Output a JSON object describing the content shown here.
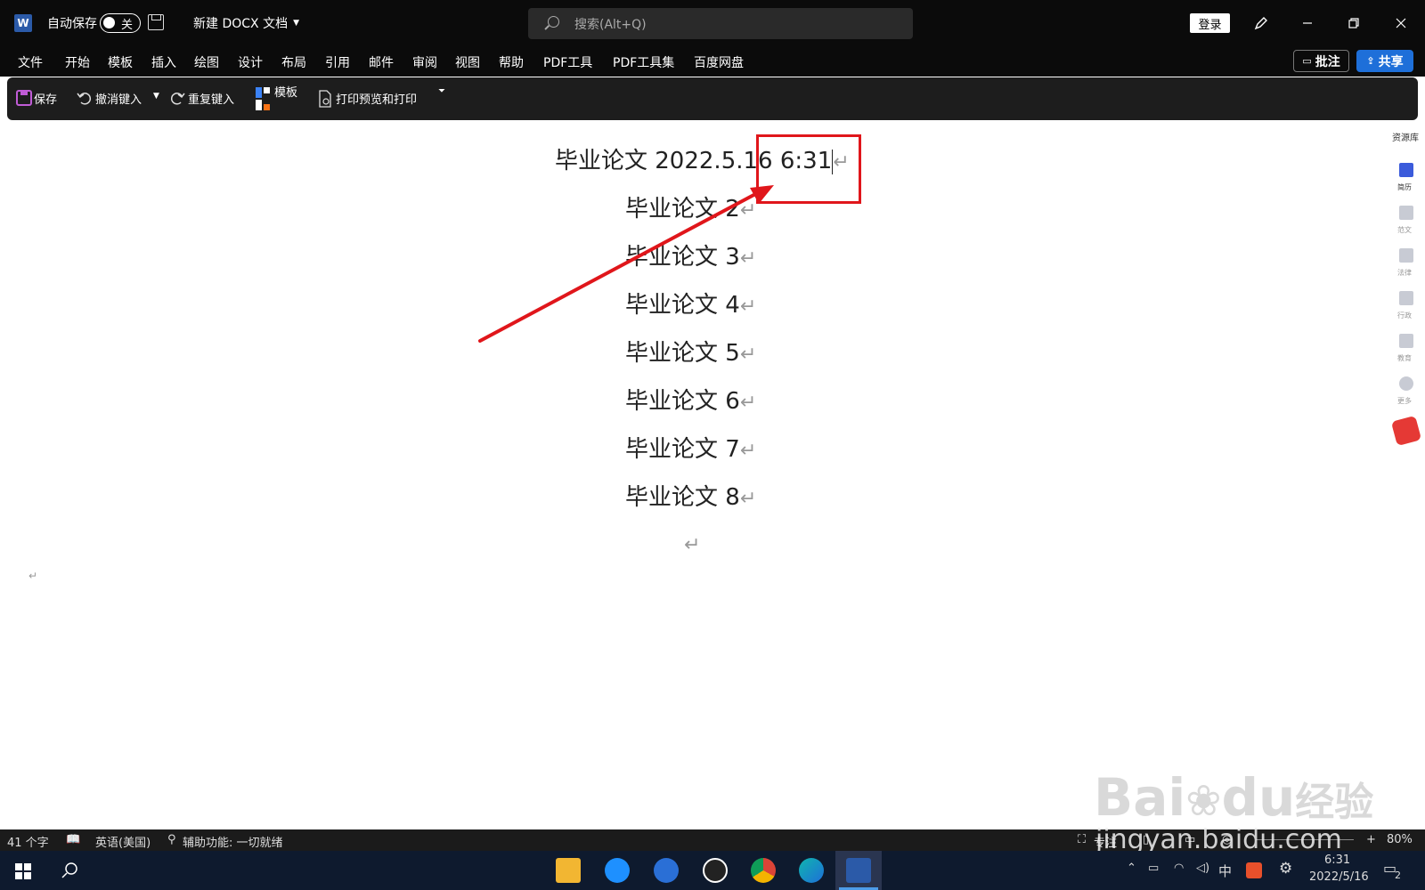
{
  "titlebar": {
    "app_icon": "W",
    "autosave_label": "自动保存",
    "autosave_toggle": "关",
    "doc_title": "新建 DOCX 文档",
    "search_placeholder": "搜索(Alt+Q)",
    "login_label": "登录"
  },
  "menu": {
    "items": [
      "文件",
      "开始",
      "模板",
      "插入",
      "绘图",
      "设计",
      "布局",
      "引用",
      "邮件",
      "审阅",
      "视图",
      "帮助",
      "PDF工具",
      "PDF工具集",
      "百度网盘"
    ],
    "comments_label": "批注",
    "share_label": "共享"
  },
  "quick_access": {
    "save_label": "保存",
    "undo_label": "撤消键入",
    "redo_label": "重复键入",
    "template_label": "模板",
    "print_label": "打印预览和打印"
  },
  "document": {
    "lines": [
      "毕业论文 2022.5.16 6:31",
      "毕业论文 2",
      "毕业论文 3",
      "毕业论文 4",
      "毕业论文 5",
      "毕业论文 6",
      "毕业论文 7",
      "毕业论文 8"
    ],
    "paragraph_mark": "↵"
  },
  "sidebar": {
    "title": "资源库",
    "items": [
      "简历",
      "范文",
      "法律",
      "行政",
      "教育",
      "更多"
    ]
  },
  "watermark": {
    "brand": "Bai",
    "du": "du",
    "jingyan": "经验",
    "url": "jingyan.baidu.com"
  },
  "statusbar": {
    "word_count": "41 个字",
    "language": "英语(美国)",
    "accessibility": "辅助功能: 一切就绪",
    "focus": "专注",
    "zoom": "80%"
  },
  "taskbar": {
    "input_method": "中",
    "time": "6:31",
    "date": "2022/5/16",
    "notification_count": "2"
  },
  "colors": {
    "annotation_red": "#e0161b",
    "share_blue": "#1e6fd9"
  }
}
